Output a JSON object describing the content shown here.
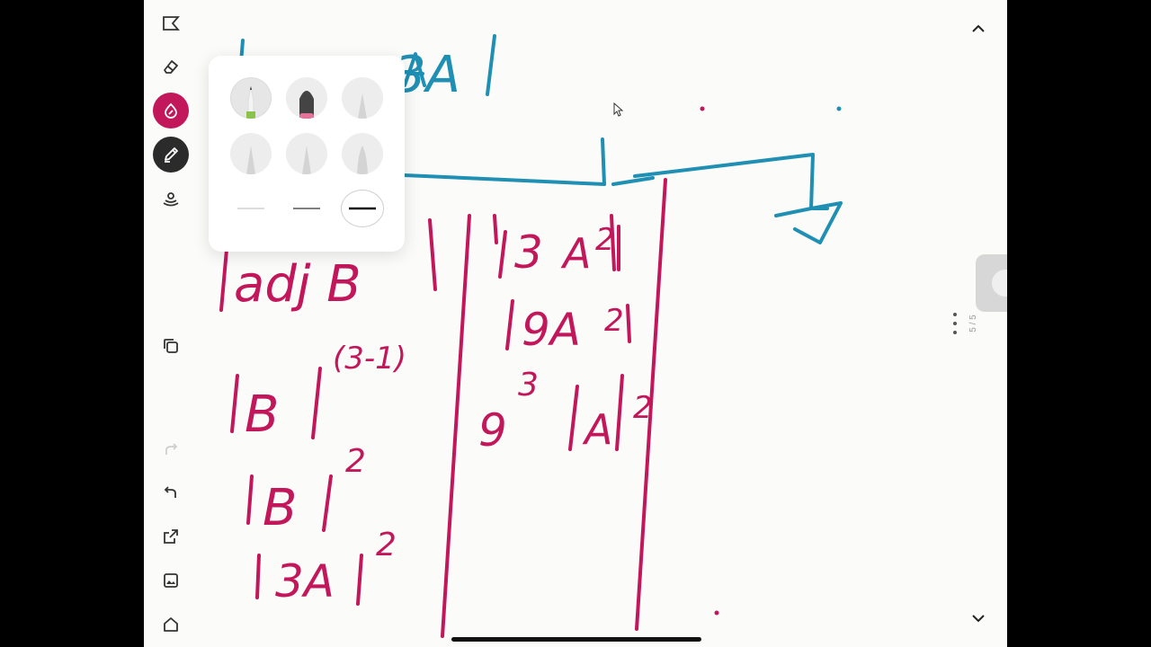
{
  "toolbar": {
    "tools": [
      {
        "name": "select-icon",
        "active": false
      },
      {
        "name": "eraser-icon",
        "active": false
      },
      {
        "name": "color-icon",
        "active": true,
        "color": "#c2185b"
      },
      {
        "name": "pen-icon",
        "active": true,
        "color": "#2b2b2b"
      },
      {
        "name": "audio-icon",
        "active": false
      },
      {
        "name": "duplicate-icon",
        "active": false
      },
      {
        "name": "redo-icon",
        "active": false
      },
      {
        "name": "undo-icon",
        "active": false
      },
      {
        "name": "share-icon",
        "active": false
      },
      {
        "name": "image-icon",
        "active": false
      },
      {
        "name": "home-icon",
        "active": false
      }
    ]
  },
  "pen_popup": {
    "pens": [
      {
        "name": "pencil",
        "tip_color": "#8bc34a",
        "selected": true
      },
      {
        "name": "marker",
        "tip_color": "#e57399",
        "selected": false
      },
      {
        "name": "pen-3",
        "selected": false
      },
      {
        "name": "pen-4",
        "selected": false
      },
      {
        "name": "pen-5",
        "selected": false
      },
      {
        "name": "pen-6",
        "selected": false
      }
    ],
    "thickness": [
      "thin",
      "medium",
      "thick"
    ],
    "selected_thickness": "thick"
  },
  "canvas": {
    "ink_colors": {
      "blue": "#1f8fb3",
      "pink": "#c2185b"
    },
    "visible_fragment_top": "3A",
    "pink_lines": [
      "adj B",
      "(3-1)",
      "B",
      "B",
      "2",
      "3A",
      "2",
      "3",
      "A",
      "2",
      "9A",
      "2",
      "9",
      "3",
      "A",
      "2"
    ]
  },
  "page_indicator": "5 / 5"
}
